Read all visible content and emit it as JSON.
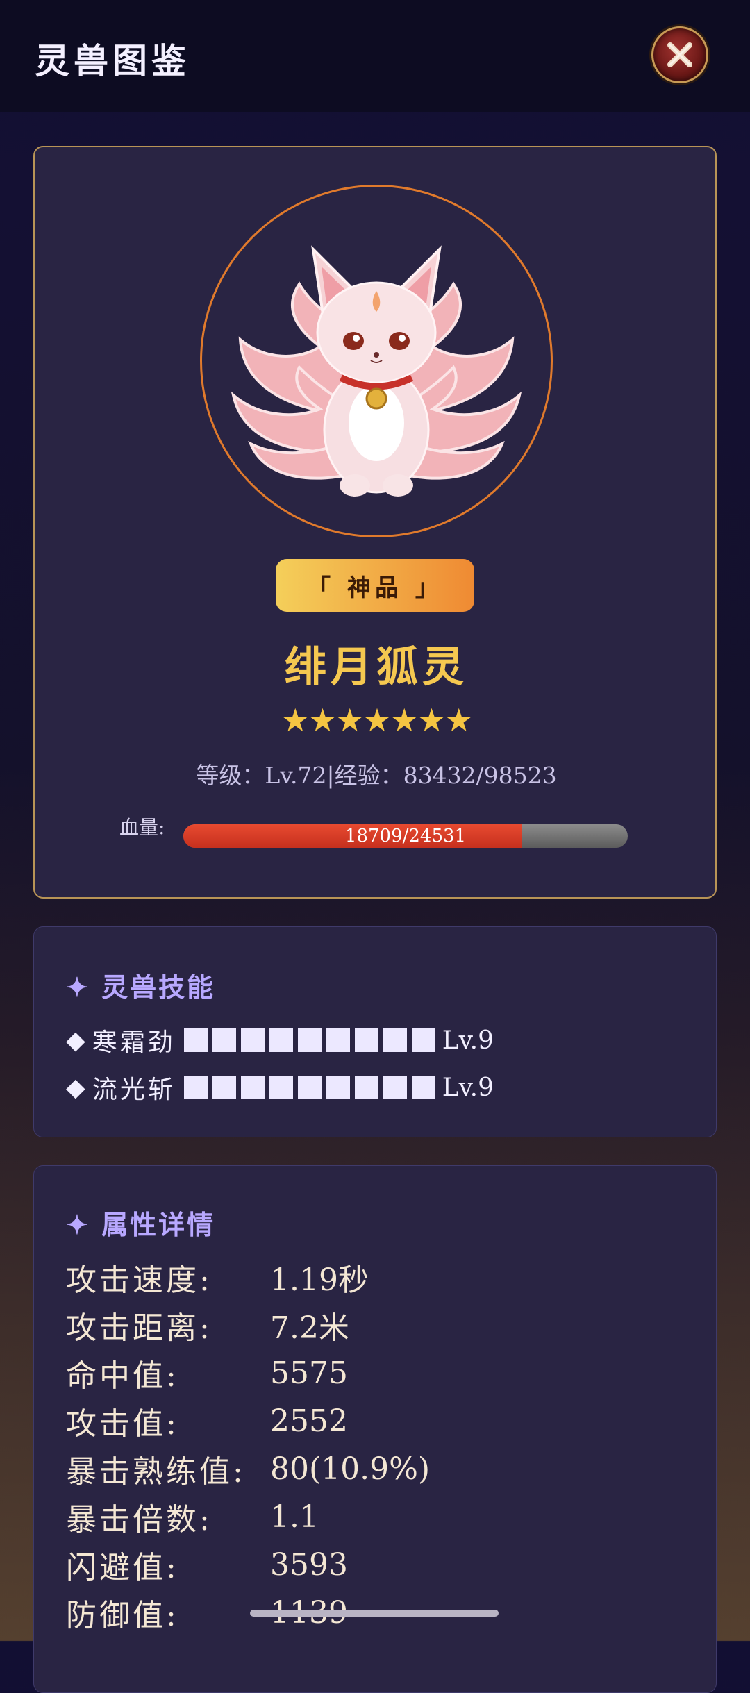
{
  "header": {
    "title": "灵兽图鉴"
  },
  "pet": {
    "grade": "「 神品 」",
    "name": "绯月狐灵",
    "stars": "★★★★★★★",
    "star_count": 7,
    "level_line": "等级：Lv.72|经验：83432/98523",
    "hp_label": "血量:",
    "hp_text": "18709/24531",
    "hp_fraction": 0.7627
  },
  "skills": {
    "title": "✦ 灵兽技能",
    "items": [
      {
        "marker": "◆",
        "name": "寒霜劲",
        "level": "Lv.9",
        "filled_blocks": 9
      },
      {
        "marker": "◆",
        "name": "流光斩",
        "level": "Lv.9",
        "filled_blocks": 9
      }
    ]
  },
  "attributes": {
    "title": "✦ 属性详情",
    "rows": [
      {
        "label": "攻击速度:",
        "value": "1.19秒"
      },
      {
        "label": "攻击距离:",
        "value": "7.2米"
      },
      {
        "label": "命中值:",
        "value": "5575"
      },
      {
        "label": "攻击值:",
        "value": "2552"
      },
      {
        "label": "暴击熟练值:",
        "value": "80(10.9%)"
      },
      {
        "label": "暴击倍数:",
        "value": "1.1"
      },
      {
        "label": "闪避值:",
        "value": "3593"
      },
      {
        "label": "防御值:",
        "value": "1139"
      }
    ]
  },
  "colors": {
    "accent_gold": "#f5c850",
    "hp_red": "#d9381f",
    "skill_title": "#b8a8ff",
    "avatar_ring": "#e07a2c"
  },
  "icons": {
    "close": "close-x-icon",
    "avatar": "nine-tailed-fox-illustration"
  }
}
